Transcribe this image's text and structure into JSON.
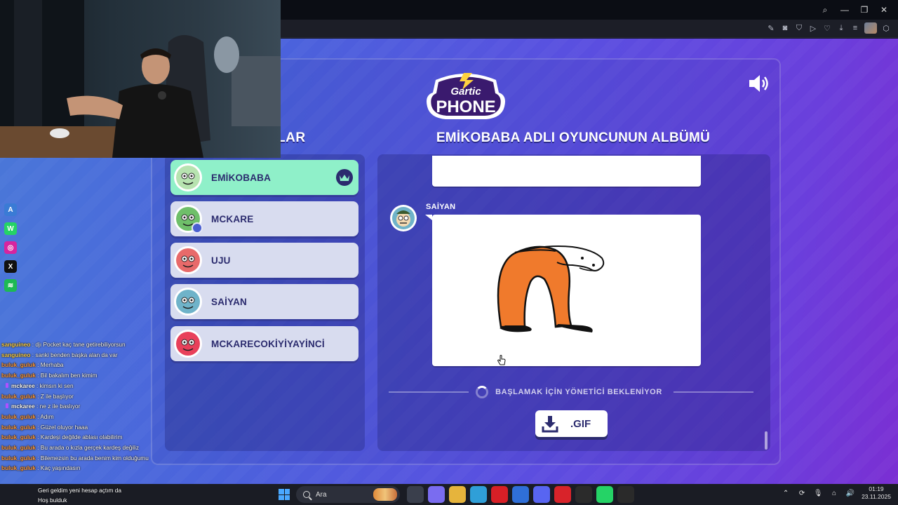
{
  "browser": {
    "toolbar_icons": [
      "search-icon",
      "minimize-icon",
      "restore-icon",
      "close-icon"
    ]
  },
  "game": {
    "logo_top": "Gartic",
    "logo_bottom": "PHONE",
    "players_heading": "LAR",
    "album_heading": "EMİKOBABA ADLI OYUNCUNUN ALBÜMÜ",
    "players": [
      {
        "name": "EMİKOBABA",
        "active": true,
        "host": true,
        "avatar_color": "#b7e3b0"
      },
      {
        "name": "MCKARE",
        "active": false,
        "host": false,
        "avatar_color": "#6fbf6a"
      },
      {
        "name": "UJU",
        "active": false,
        "host": false,
        "avatar_color": "#e86a6a"
      },
      {
        "name": "SAİYAN",
        "active": false,
        "host": false,
        "avatar_color": "#6fb3c9"
      },
      {
        "name": "MCKARECOKİYİYAYİNCİ",
        "active": false,
        "host": false,
        "avatar_color": "#e8405a"
      }
    ],
    "album": {
      "drawer_name": "SAİYAN",
      "waiting_text": "BAŞLAMAK İÇİN YÖNETİCİ BEKLENİYOR",
      "gif_button": ".GIF"
    }
  },
  "chat": [
    {
      "user": "sanguineo",
      "text": "djı Pocket kaç tane getirebiliyorsun",
      "color": "#ffd24a",
      "badge": false
    },
    {
      "user": "sanguineo",
      "text": "sanki benden başka alan da var",
      "color": "#ffd24a",
      "badge": false
    },
    {
      "user": "buluk_guluk",
      "text": "Merhaba",
      "color": "#ff9a3a",
      "badge": false
    },
    {
      "user": "buluk_guluk",
      "text": "Bil bakalım ben kimim",
      "color": "#ff9a3a",
      "badge": false
    },
    {
      "user": "mckaree",
      "text": "kimsın ki sen",
      "color": "#ffffff",
      "badge": true
    },
    {
      "user": "buluk_guluk",
      "text": "Z ile başlıyor",
      "color": "#ff9a3a",
      "badge": false
    },
    {
      "user": "mckaree",
      "text": "ne z ile baslıyor",
      "color": "#ffffff",
      "badge": true
    },
    {
      "user": "buluk_guluk",
      "text": "Adım",
      "color": "#ff9a3a",
      "badge": false
    },
    {
      "user": "buluk_guluk",
      "text": "Güzel oluyor haaa",
      "color": "#ff9a3a",
      "badge": false
    },
    {
      "user": "buluk_guluk",
      "text": "Kardeşi değilde ablası olabilirim",
      "color": "#ff9a3a",
      "badge": false
    },
    {
      "user": "buluk_guluk",
      "text": "Bu arada o kızla gerçek kardeş değiliz",
      "color": "#ff9a3a",
      "badge": false
    },
    {
      "user": "buluk_guluk",
      "text": "Bilemezsin bu arada benim kim olduğumu",
      "color": "#ff9a3a",
      "badge": false
    },
    {
      "user": "buluk_guluk",
      "text": "Kaç yaşındasın",
      "color": "#ff9a3a",
      "badge": false
    }
  ],
  "chat_bottom": [
    {
      "user": "",
      "text": "Geri geldim yeni hesap açtım da"
    },
    {
      "user": "",
      "text": "Hoş bulduk"
    }
  ],
  "side_icons": [
    {
      "name": "app-icon",
      "color": "#3a7bd5",
      "glyph": "A"
    },
    {
      "name": "whatsapp-icon",
      "color": "#25d366",
      "glyph": "W"
    },
    {
      "name": "instagram-icon",
      "color": "#d6249f",
      "glyph": "◎"
    },
    {
      "name": "x-icon",
      "color": "#111111",
      "glyph": "X"
    },
    {
      "name": "spotify-icon",
      "color": "#1db954",
      "glyph": "≋"
    }
  ],
  "taskbar": {
    "search_placeholder": "Ara",
    "time": "01:19",
    "date": "23.11.2025",
    "apps": [
      {
        "name": "files-app-icon",
        "color": "#3a3f4c"
      },
      {
        "name": "copilot-icon",
        "color": "#7a6cf0"
      },
      {
        "name": "folder-icon",
        "color": "#e6b43c"
      },
      {
        "name": "edge-icon",
        "color": "#2f9fd8"
      },
      {
        "name": "netflix-icon",
        "color": "#d81f26"
      },
      {
        "name": "mail-icon",
        "color": "#2f6fd8"
      },
      {
        "name": "discord-icon",
        "color": "#5865f2"
      },
      {
        "name": "opera-icon",
        "color": "#d8232a"
      },
      {
        "name": "obs-icon",
        "color": "#2b2b2b"
      },
      {
        "name": "whatsapp-taskbar-icon",
        "color": "#25d366"
      },
      {
        "name": "epic-games-icon",
        "color": "#2a2a2a"
      }
    ]
  }
}
